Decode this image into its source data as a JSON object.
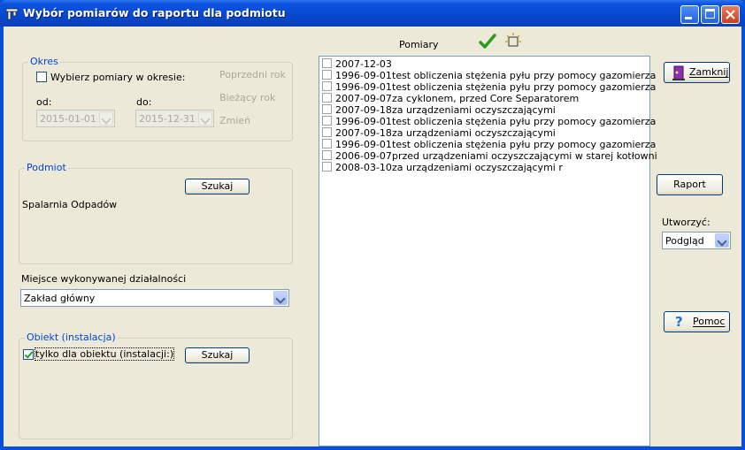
{
  "window": {
    "title": "Wybór pomiarów do raportu dla podmiotu"
  },
  "okres": {
    "group_title": "Okres",
    "checkbox_label": "Wybierz pomiary w okresie:",
    "checked": false,
    "od_label": "od:",
    "od_value": "2015-01-01",
    "do_label": "do:",
    "do_value": "2015-12-31",
    "prev_year": "Poprzedni rok",
    "current_year": "Bieżący rok",
    "change": "Zmień"
  },
  "podmiot": {
    "group_title": "Podmiot",
    "search_button": "Szukaj",
    "name": "Spalarnia Odpadów"
  },
  "miejsce": {
    "label": "Miejsce wykonywanej działalności",
    "value": "Zakład główny"
  },
  "obiekt": {
    "group_title": "Obiekt (instalacja)",
    "checkbox_label": "tylko dla obiektu (instalacji:)",
    "checked": true,
    "search_button": "Szukaj"
  },
  "pomiary": {
    "header": "Pomiary",
    "items": [
      {
        "date": "2007-12-03",
        "desc": ""
      },
      {
        "date": "1996-09-01",
        "desc": "test obliczenia stężenia pyłu przy pomocy gazomierza"
      },
      {
        "date": "1996-09-01",
        "desc": "test obliczenia stężenia pyłu przy pomocy gazomierza"
      },
      {
        "date": "2007-09-07",
        "desc": "za cyklonem, przed Core Separatorem"
      },
      {
        "date": "2007-09-18",
        "desc": "za urządzeniami oczyszczającymi"
      },
      {
        "date": "1996-09-01",
        "desc": "test obliczenia stężenia pyłu przy pomocy gazomierza"
      },
      {
        "date": "2007-09-18",
        "desc": "za urządzeniami oczyszczającymi"
      },
      {
        "date": "1996-09-01",
        "desc": "test obliczenia stężenia pyłu przy pomocy gazomierza"
      },
      {
        "date": "2006-09-07",
        "desc": "przed urządzeniami oczyszczającymi w starej kotłowni"
      },
      {
        "date": "2008-03-10",
        "desc": "za urządzeniami oczyszczającymi r"
      }
    ]
  },
  "right": {
    "close_button": "Zamknij",
    "report_button": "Raport",
    "create_label": "Utworzyć:",
    "create_value": "Podgląd",
    "help_button": "Pomoc"
  },
  "colors": {
    "title_bar": "#0a4fd8",
    "group_title": "#0046d5",
    "check_green": "#21a121"
  }
}
